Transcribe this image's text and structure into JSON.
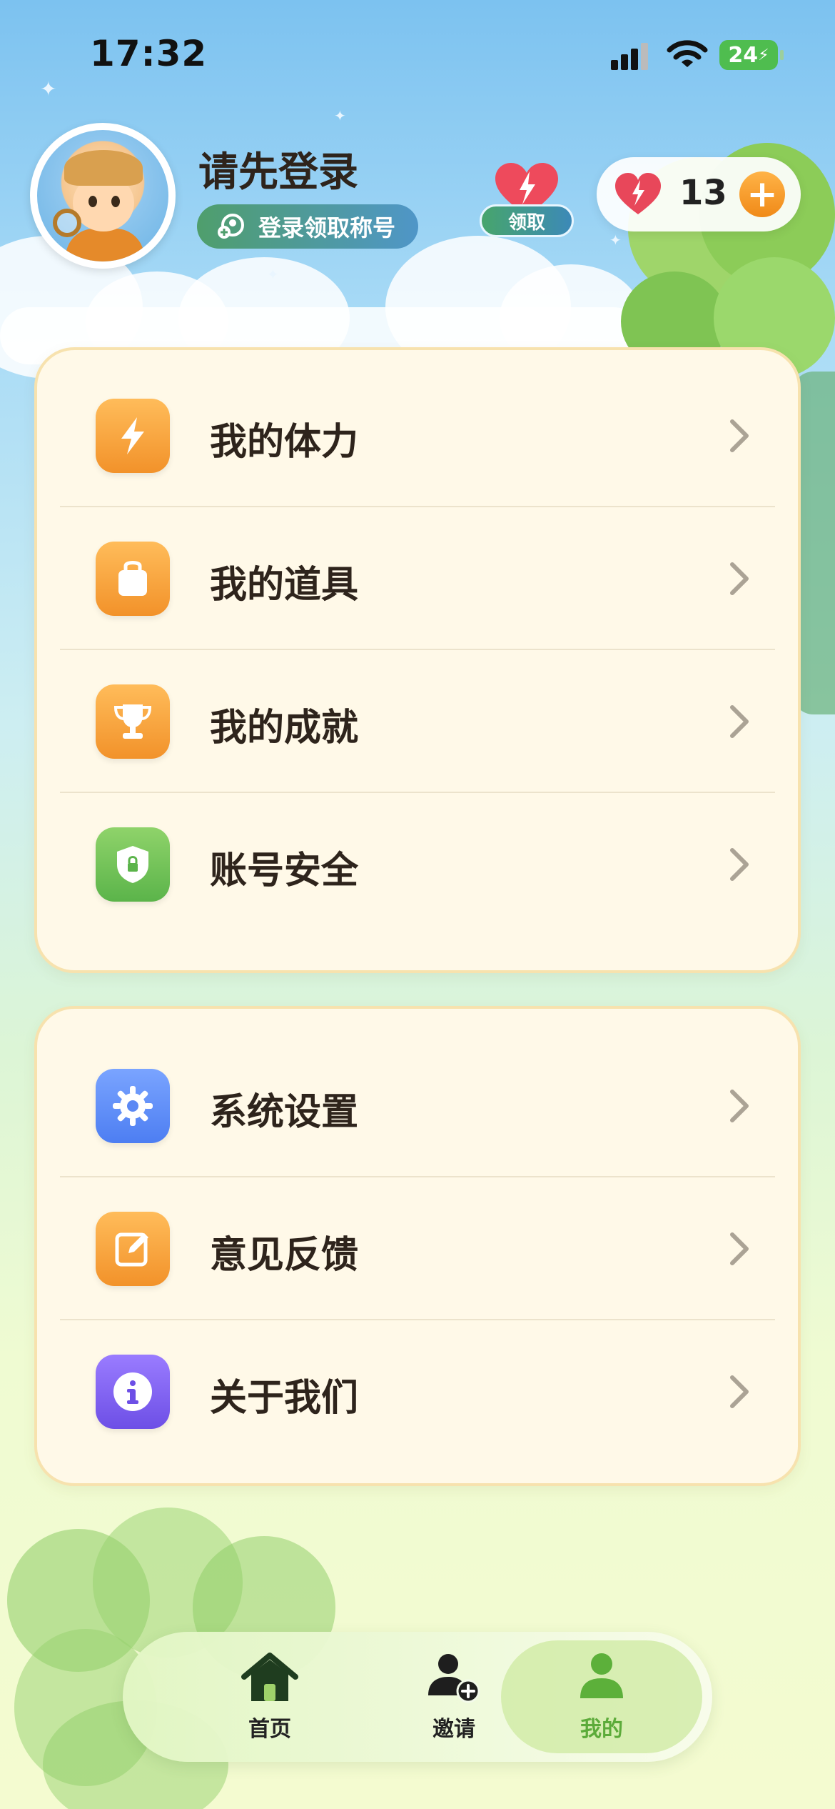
{
  "status_bar": {
    "time": "17:32",
    "battery": "24"
  },
  "header": {
    "title": "请先登录",
    "title_button": "登录领取称号",
    "claim_label": "领取",
    "hearts_count": "13"
  },
  "menu_primary": [
    {
      "label": "我的体力",
      "icon": "lightning-icon",
      "color": "#f2922a"
    },
    {
      "label": "我的道具",
      "icon": "bag-icon",
      "color": "#f2922a"
    },
    {
      "label": "我的成就",
      "icon": "trophy-icon",
      "color": "#f2922a"
    },
    {
      "label": "账号安全",
      "icon": "shield-lock-icon",
      "color": "#5bb44a"
    }
  ],
  "menu_secondary": [
    {
      "label": "系统设置",
      "icon": "gear-icon",
      "color": "#4d7ef2"
    },
    {
      "label": "意见反馈",
      "icon": "edit-icon",
      "color": "#f2922a"
    },
    {
      "label": "关于我们",
      "icon": "info-icon",
      "color": "#6d4fe6"
    }
  ],
  "tabbar": {
    "home": "首页",
    "invite": "邀请",
    "me": "我的",
    "active": "me"
  }
}
